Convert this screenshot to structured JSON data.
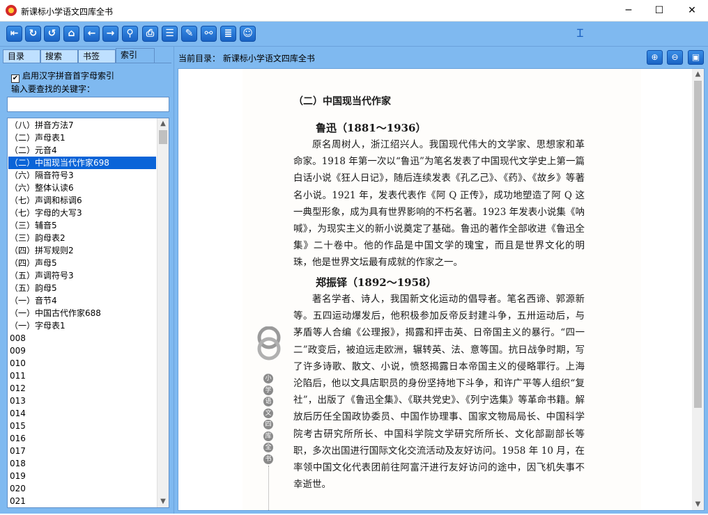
{
  "window": {
    "title": "新课标小学语文四库全书",
    "min_glyph": "─",
    "max_glyph": "☐",
    "close_glyph": "✕"
  },
  "toolbar": {
    "buttons": [
      {
        "name": "exit-icon",
        "glyph": "⇤"
      },
      {
        "name": "refresh-icon",
        "glyph": "↻"
      },
      {
        "name": "reload-icon",
        "glyph": "↺"
      },
      {
        "name": "home-icon",
        "glyph": "⌂"
      },
      {
        "name": "back-arrow-icon",
        "glyph": "←"
      },
      {
        "name": "forward-arrow-icon",
        "glyph": "→"
      },
      {
        "name": "search-icon",
        "glyph": "⚲"
      },
      {
        "name": "print-icon",
        "glyph": "⎙"
      },
      {
        "name": "document-icon",
        "glyph": "☰"
      },
      {
        "name": "edit-icon",
        "glyph": "✎"
      },
      {
        "name": "link-icon",
        "glyph": "⚯"
      },
      {
        "name": "notes-icon",
        "glyph": "≣"
      },
      {
        "name": "smiley-icon",
        "glyph": "☺"
      }
    ],
    "cursor_glyph": "Ɪ"
  },
  "left_panel": {
    "tabs": [
      "目录",
      "搜索",
      "书签",
      "索引"
    ],
    "active_tab": 3,
    "checkbox_label": "启用汉字拼音首字母索引",
    "checkbox_mark": "✔",
    "keyword_label": "输入要查找的关键字：",
    "keyword_value": "",
    "index_items": [
      "（八）拼音方法7",
      "（二）声母表1",
      "（二）元音4",
      "（二）中国现当代作家698",
      "（六）隔音符号3",
      "（六）整体认读6",
      "（七）声调和标调6",
      "（七）字母的大写3",
      "（三）辅音5",
      "（三）韵母表2",
      "（四）拼写规则2",
      "（四）声母5",
      "（五）声调符号3",
      "（五）韵母5",
      "（一）音节4",
      "（一）中国古代作家688",
      "（一）字母表1",
      "008",
      "009",
      "010",
      "011",
      "012",
      "013",
      "014",
      "015",
      "016",
      "017",
      "018",
      "019",
      "020",
      "021"
    ],
    "selected_index": 3,
    "scroll_up": "▲",
    "scroll_down": "▼"
  },
  "right_panel": {
    "current_dir": "当前目录：  新课标小学语文四库全书",
    "zoom_in_glyph": "⊕",
    "zoom_out_glyph": "⊖",
    "fullscreen_glyph": "▣",
    "scroll_up": "▲",
    "scroll_down": "▼"
  },
  "document": {
    "section_heading": "（二）中国现当代作家",
    "entries": [
      {
        "name": "鲁迅（1881～1936）",
        "text": "原名周树人，浙江绍兴人。我国现代伟大的文学家、思想家和革命家。1918 年第一次以“鲁迅”为笔名发表了中国现代文学史上第一篇白话小说《狂人日记》，随后连续发表《孔乙己》、《药》、《故乡》等著名小说。1921 年，发表代表作《阿 Q 正传》，成功地塑造了阿 Q 这一典型形象，成为具有世界影响的不朽名著。1923 年发表小说集《呐喊》，为现实主义的新小说奠定了基础。鲁迅的著作全部收进《鲁迅全集》二十卷中。他的作品是中国文学的瑰宝，而且是世界文化的明珠，他是世界文坛最有成就的作家之一。"
      },
      {
        "name": "郑振铎（1892～1958）",
        "text": "著名学者、诗人，我国新文化运动的倡导者。笔名西谛、郭源新等。五四运动爆发后，他积极参加反帝反封建斗争，五卅运动后，与茅盾等人合编《公理报》，揭露和抨击英、日帝国主义的暴行。“四一二”政变后，被迫远走欧洲，辗转英、法、意等国。抗日战争时期，写了许多诗歌、散文、小说，愤怒揭露日本帝国主义的侵略罪行。上海沦陷后，他以文具店职员的身份坚持地下斗争，和许广平等人组织“复社”，出版了《鲁迅全集》、《联共党史》、《列宁选集》等革命书籍。解放后历任全国政协委员、中国作协理事、国家文物局局长、中国科学院考古研究所所长、中国科学院文学研究所所长、文化部副部长等职，多次出国进行国际文化交流活动及友好访问。1958 年 10 月，在率领中国文化代表团前往阿富汗进行友好访问的途中，因飞机失事不幸逝世。"
      }
    ],
    "side_title_chars": [
      "小",
      "学",
      "语",
      "文",
      "四",
      "库",
      "全",
      "书"
    ]
  }
}
